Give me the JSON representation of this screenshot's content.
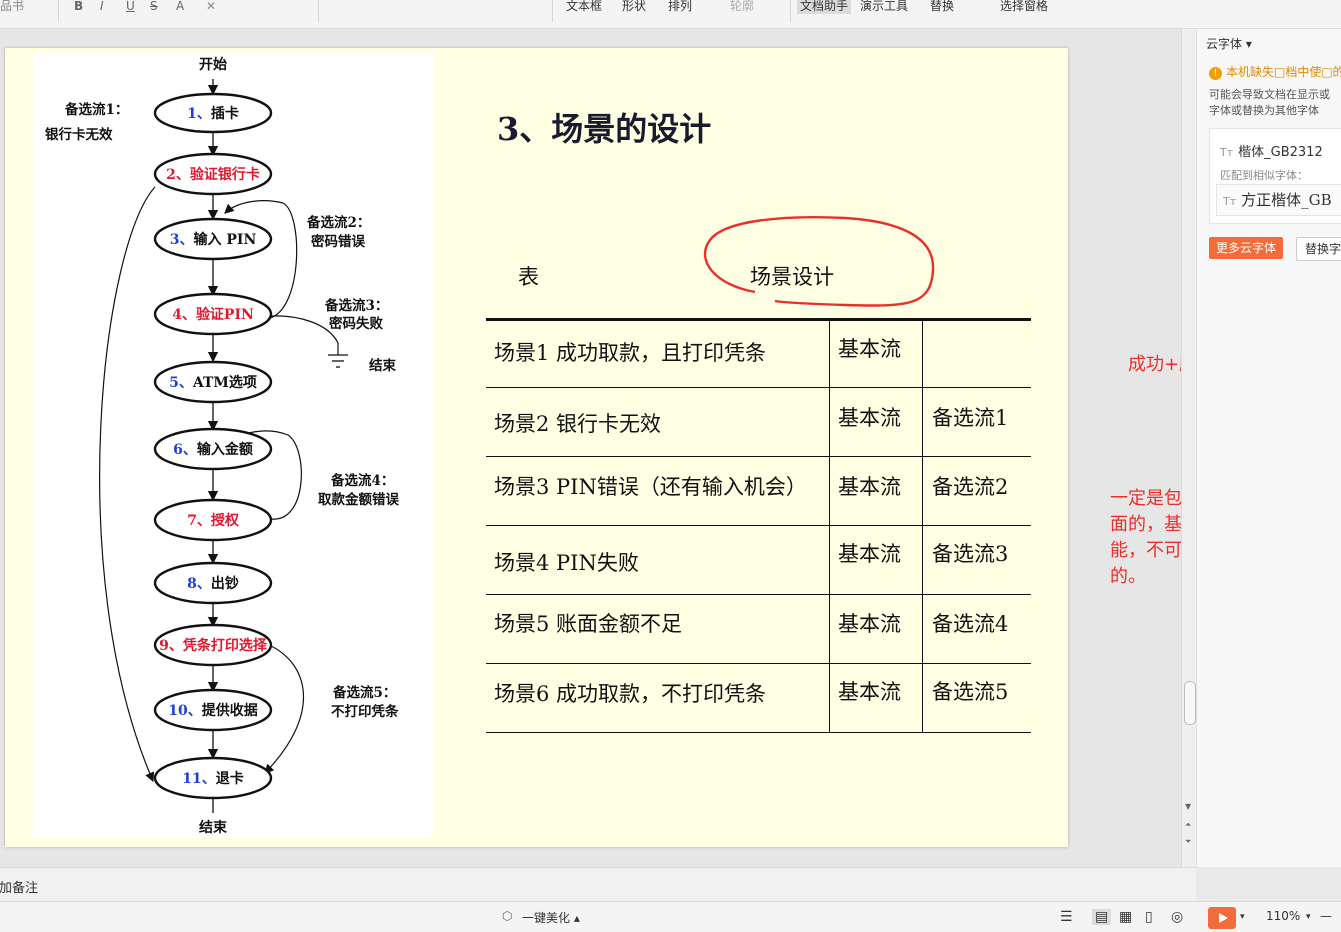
{
  "toolbar": {
    "left_cut": "品书",
    "bold": "B",
    "italic": "I",
    "underline": "U",
    "strike": "S",
    "fontcolor": "A",
    "clear": "✕",
    "textbox": "文本框",
    "shape": "形状",
    "arrange": "排列",
    "outline": "轮廓",
    "doc_assist": "文档助手",
    "present_tools": "演示工具",
    "replace": "替换",
    "select_pane": "选择窗格"
  },
  "slide": {
    "title": "3、场景的设计",
    "table_label": "表",
    "table_caption": "场景设计",
    "rows": [
      {
        "name": "场景1  成功取款，且打印凭条",
        "flow": "基本流",
        "alt": ""
      },
      {
        "name": "场景2   银行卡无效",
        "flow": "基本流",
        "alt": "备选流1"
      },
      {
        "name": "场景3   PIN错误（还有输入机会）",
        "flow": "基本流",
        "alt": "备选流2"
      },
      {
        "name": "场景4   PIN失败",
        "flow": "基本流",
        "alt": "备选流3"
      },
      {
        "name": "场景5   账面金额不足",
        "flow": "基本流",
        "alt": "备选流4"
      },
      {
        "name": "场景6    成功取款，不打印凭条",
        "flow": "基本流",
        "alt": "备选流5"
      }
    ]
  },
  "flowchart": {
    "start": "开始",
    "end": "结束",
    "nodes": [
      {
        "num": "1、",
        "text": "插卡",
        "red": false
      },
      {
        "num": "2、",
        "text": "验证银行卡",
        "red": true
      },
      {
        "num": "3、",
        "text": "输入 PIN",
        "red": false
      },
      {
        "num": "4、",
        "text": "验证PIN",
        "red": true
      },
      {
        "num": "5、",
        "text": "ATM选项",
        "red": false
      },
      {
        "num": "6、",
        "text": "输入金额",
        "red": false
      },
      {
        "num": "7、",
        "text": "授权",
        "red": true
      },
      {
        "num": "8、",
        "text": "出钞",
        "red": false
      },
      {
        "num": "9、",
        "text": "凭条打印选择",
        "red": true
      },
      {
        "num": "10、",
        "text": "提供收据",
        "red": false
      },
      {
        "num": "11、",
        "text": "退卡",
        "red": false
      }
    ],
    "alt1_title": "备选流1：",
    "alt1_desc": "银行卡无效",
    "alt2_title": "备选流2：",
    "alt2_desc": "密码错误",
    "alt3_title": "备选流3：",
    "alt3_desc": "密码失败",
    "alt3_end": "结束",
    "alt4_title": "备选流4：",
    "alt4_desc": "取款金额错误",
    "alt5_title": "备选流5：",
    "alt5_desc": "不打印凭条"
  },
  "notes": {
    "note1": "成功+所有失败的情",
    "note2": [
      "一定是包含了基本流在里",
      "面的，基本流+备选流才可",
      "能，不可能只有备选流",
      "的。"
    ]
  },
  "panel": {
    "header": "云字体 ▾",
    "warning": "本机缺失□档中使□的",
    "desc_line1": "可能会导致文档在显示或",
    "desc_line2": "字体或替换为其他字体",
    "font_missing": "楷体_GB2312",
    "match_label": "匹配到相似字体：",
    "font_match": "方正楷体_GB",
    "more_button": "更多云字体",
    "replace_button": "替换字"
  },
  "notes_bar": {
    "label": "添加备注"
  },
  "status": {
    "beautify": "一键美化 ▴",
    "zoom": "110%",
    "minus": "—"
  },
  "colors": {
    "slide_bg": "#ffffe4",
    "red_text": "#e8302a",
    "blue_num": "#1f3fd6",
    "red_num": "#e0182d",
    "accent": "#f26c3b"
  }
}
